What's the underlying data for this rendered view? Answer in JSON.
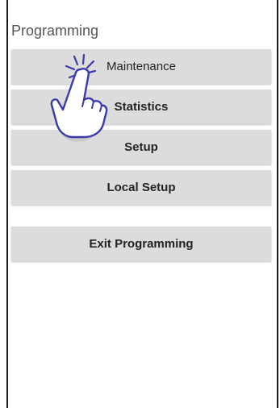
{
  "header": {
    "title": "Programming"
  },
  "menu": {
    "items": [
      {
        "label": "Maintenance"
      },
      {
        "label": "Statistics"
      },
      {
        "label": "Setup"
      },
      {
        "label": "Local Setup"
      }
    ],
    "exit_label": "Exit Programming"
  },
  "colors": {
    "button_bg": "#dcdcdc",
    "hand_stroke": "#3a3aa8",
    "title_text": "#555555"
  },
  "icons": {
    "tap_hint": "tap-hand-icon"
  }
}
